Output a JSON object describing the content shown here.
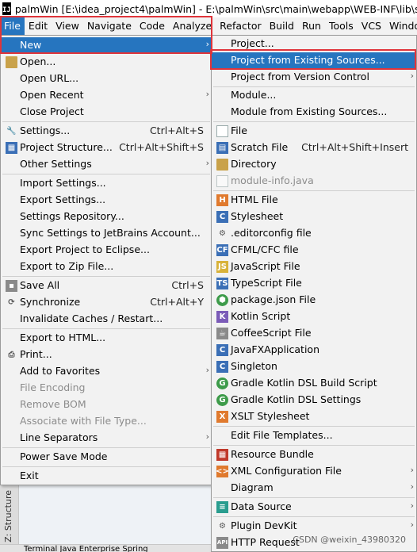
{
  "window": {
    "app_icon": "IJ",
    "title": "palmWin [E:\\idea_project4\\palmWin] - E:\\palmWin\\src\\main\\webapp\\WEB-INF\\lib\\spring"
  },
  "menubar": [
    "File",
    "Edit",
    "View",
    "Navigate",
    "Code",
    "Analyze",
    "Refactor",
    "Build",
    "Run",
    "Tools",
    "VCS",
    "Window"
  ],
  "file_menu": [
    {
      "label": "New",
      "arrow": "›",
      "selected": true
    },
    {
      "label": "Open...",
      "icon": "folder-icon"
    },
    {
      "label": "Open URL..."
    },
    {
      "label": "Open Recent",
      "arrow": "›"
    },
    {
      "label": "Close Project"
    },
    {
      "label": "Settings...",
      "icon": "wrench-icon",
      "shortcut": "Ctrl+Alt+S"
    },
    {
      "label": "Project Structure...",
      "icon": "structure-icon",
      "shortcut": "Ctrl+Alt+Shift+S"
    },
    {
      "label": "Other Settings",
      "arrow": "›"
    },
    {
      "label": "Import Settings..."
    },
    {
      "label": "Export Settings..."
    },
    {
      "label": "Settings Repository..."
    },
    {
      "label": "Sync Settings to JetBrains Account..."
    },
    {
      "label": "Export Project to Eclipse..."
    },
    {
      "label": "Export to Zip File..."
    },
    {
      "label": "Save All",
      "icon": "save-icon",
      "shortcut": "Ctrl+S"
    },
    {
      "label": "Synchronize",
      "icon": "sync-icon",
      "shortcut": "Ctrl+Alt+Y"
    },
    {
      "label": "Invalidate Caches / Restart..."
    },
    {
      "label": "Export to HTML..."
    },
    {
      "label": "Print...",
      "icon": "print-icon"
    },
    {
      "label": "Add to Favorites",
      "arrow": "›"
    },
    {
      "label": "File Encoding",
      "disabled": true
    },
    {
      "label": "Remove BOM",
      "disabled": true
    },
    {
      "label": "Associate with File Type...",
      "disabled": true
    },
    {
      "label": "Line Separators",
      "arrow": "›"
    },
    {
      "label": "Power Save Mode"
    },
    {
      "label": "Exit"
    }
  ],
  "new_menu": [
    {
      "label": "Project..."
    },
    {
      "label": "Project from Existing Sources...",
      "selected": true
    },
    {
      "label": "Project from Version Control",
      "arrow": "›"
    },
    {
      "label": "Module..."
    },
    {
      "label": "Module from Existing Sources..."
    },
    {
      "label": "File",
      "icon": "file-icon"
    },
    {
      "label": "Scratch File",
      "icon": "scratch-file-icon",
      "shortcut": "Ctrl+Alt+Shift+Insert"
    },
    {
      "label": "Directory",
      "icon": "directory-icon"
    },
    {
      "label": "module-info.java",
      "icon": "module-info-icon",
      "disabled": true
    },
    {
      "label": "HTML File",
      "icon": "html-file-icon"
    },
    {
      "label": "Stylesheet",
      "icon": "css-file-icon"
    },
    {
      "label": ".editorconfig file",
      "icon": "editorconfig-icon"
    },
    {
      "label": "CFML/CFC file",
      "icon": "cfml-icon"
    },
    {
      "label": "JavaScript File",
      "icon": "javascript-icon"
    },
    {
      "label": "TypeScript File",
      "icon": "typescript-icon"
    },
    {
      "label": "package.json File",
      "icon": "package-json-icon"
    },
    {
      "label": "Kotlin Script",
      "icon": "kotlin-icon"
    },
    {
      "label": "CoffeeScript File",
      "icon": "coffeescript-icon"
    },
    {
      "label": "JavaFXApplication",
      "icon": "javafx-icon"
    },
    {
      "label": "Singleton",
      "icon": "singleton-icon"
    },
    {
      "label": "Gradle Kotlin DSL Build Script",
      "icon": "gradle-icon"
    },
    {
      "label": "Gradle Kotlin DSL Settings",
      "icon": "gradle-icon"
    },
    {
      "label": "XSLT Stylesheet",
      "icon": "xslt-icon"
    },
    {
      "label": "Edit File Templates..."
    },
    {
      "label": "Resource Bundle",
      "icon": "resource-bundle-icon"
    },
    {
      "label": "XML Configuration File",
      "icon": "xml-config-icon",
      "arrow": "›"
    },
    {
      "label": "Diagram",
      "arrow": "›"
    },
    {
      "label": "Data Source",
      "icon": "database-icon",
      "arrow": "›"
    },
    {
      "label": "Plugin DevKit",
      "icon": "plugin-devkit-icon",
      "arrow": "›"
    },
    {
      "label": "HTTP Request",
      "icon": "http-request-icon"
    }
  ],
  "side_strip_label": "Z: Structure",
  "bottom_bar": "Terminal    Java Enterprise    Spring",
  "watermark": "CSDN @weixin_43980320",
  "colors": {
    "selection": "#2675bf",
    "highlight_box": "#e0343a",
    "menu_bg": "#f2f2f2"
  }
}
